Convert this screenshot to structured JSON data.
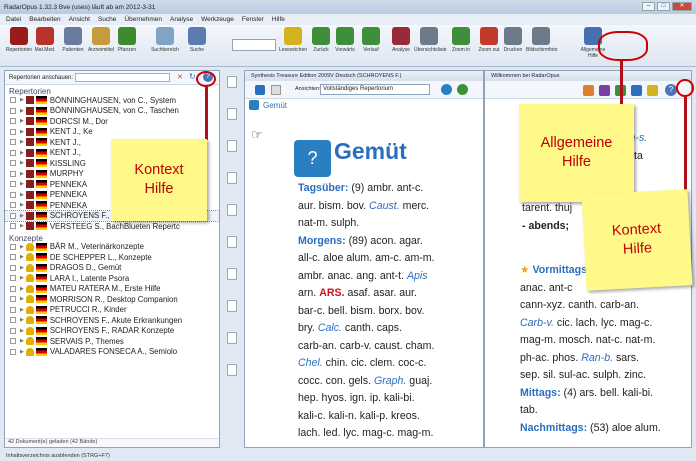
{
  "window": {
    "title": "RadarOpus 1.32.3 Bve (uses) läuft ab am 2012-3-31"
  },
  "menu": [
    "Datei",
    "Bearbeiten",
    "Ansicht",
    "Suche",
    "Übernehmen",
    "Analyse",
    "Werkzeuge",
    "Fenster",
    "Hilfe"
  ],
  "toolbar": {
    "buttons": [
      {
        "label": "Repertorien",
        "icon": "book-icon",
        "color": "#9b1b1b"
      },
      {
        "label": "Mat.Med.",
        "icon": "book-icon",
        "color": "#b8332a"
      },
      {
        "label": "Patienten",
        "icon": "people-icon",
        "color": "#6a7aa0"
      },
      {
        "label": "Arzneimittel",
        "icon": "box-icon",
        "color": "#c79a3a"
      },
      {
        "label": "Pfanzen",
        "icon": "tree-icon",
        "color": "#3d8a2f"
      },
      {
        "label": "Suchbereich",
        "icon": "search-area-icon",
        "color": "#7fa4c8"
      },
      {
        "label": "Suche",
        "icon": "search-icon",
        "color": "#5a7db0"
      },
      {
        "label": "Lesezeichen",
        "icon": "bookmark-icon",
        "color": "#d4b21c"
      },
      {
        "label": "Zurück",
        "icon": "back-arrow-icon",
        "color": "#3f8f3a"
      },
      {
        "label": "Vorwärts",
        "icon": "forward-arrow-icon",
        "color": "#3f8f3a"
      },
      {
        "label": "Verlauf",
        "icon": "history-icon",
        "color": "#3f8f3a"
      },
      {
        "label": "Analyse",
        "icon": "analysis-icon",
        "color": "#9a2a3a"
      },
      {
        "label": "Übersichtsliste",
        "icon": "overview-icon",
        "color": "#6c7a8a"
      },
      {
        "label": "Zoom in",
        "icon": "zoom-in-icon",
        "color": "#3f8f3a"
      },
      {
        "label": "Zoom out",
        "icon": "zoom-out-icon",
        "color": "#c0392b"
      },
      {
        "label": "Drucken",
        "icon": "print-icon",
        "color": "#6c7a8a"
      },
      {
        "label": "Bildschirmfoto",
        "icon": "camera-icon",
        "color": "#6c7a8a"
      },
      {
        "label": "Allgemeine Hilfe",
        "icon": "help-book-icon",
        "color": "#4a6fb0"
      }
    ]
  },
  "sidebar": {
    "search_label": "Repertorien anschauen:",
    "sections": [
      {
        "title": "Repertorien",
        "items": [
          "BÖNNINGHAUSEN, von C., System",
          "BÖNNINGHAUSEN, von C., Taschen",
          "DORCSI M., Dor",
          "KENT J., Ke",
          "KENT J.,",
          "KENT J.,",
          "KISSLING",
          "MURPHY",
          "PENNEKA",
          "PENNEKA",
          "PENNEKA",
          "SCHROYENS F., Synthesis Treasure",
          "VERSTEEG S., BachBlueten Repertc"
        ]
      },
      {
        "title": "Konzepte",
        "items": [
          "BÄR M., Veterinärkonzepte",
          "DE SCHEPPER L., Konzepte",
          "DRAGOS D., Gemüt",
          "LARA I., Latente Psora",
          "MATEU RATERA M., Erste Hilfe",
          "MORRISON R., Desktop Companion",
          "PETRUCCI R., Kinder",
          "SCHROYENS F., Akute Erkrankungen",
          "SCHROYENS F., RADAR Konzepte",
          "SERVAIS P., Themes",
          "VALADARES FONSECA A., Semiolo"
        ]
      }
    ],
    "status": "42 Dokument(e) geladen (42 Bände)"
  },
  "doc1": {
    "tab": "Synthesis Treasure Edition 2009V Deutsch (SCHROYENS F.)",
    "view_label": "Ansichten:",
    "view_value": "Vollständiges Repertorium",
    "crumb": "Gemüt",
    "title": "Gemüt"
  },
  "doc2": {
    "tab": "Willkommen bei RadarOpus"
  },
  "notes": {
    "kontext_left": "Kontext Hilfe",
    "allgemeine": "Allgemeine Hilfe",
    "kontext_right": "Kontext Hilfe"
  },
  "statusbar": "Inhaltsverzeichnis ausblenden (STRG+F7)"
}
